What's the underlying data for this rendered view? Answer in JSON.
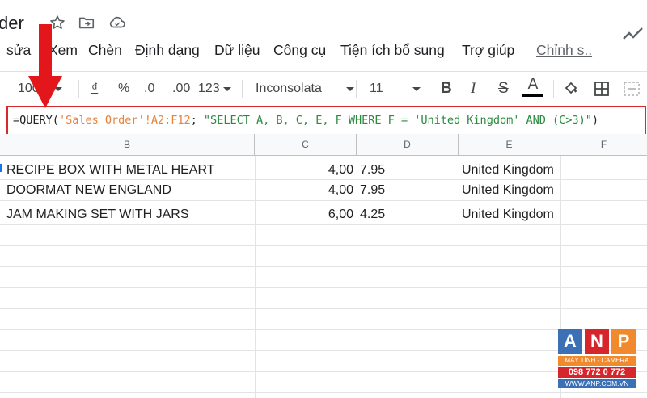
{
  "app": {
    "doc_title_fragment": "der"
  },
  "menu": {
    "items": [
      "sửa",
      "Xem",
      "Chèn",
      "Định dạng",
      "Dữ liệu",
      "Công cụ",
      "Tiện ích bổ sung",
      "Trợ giúp"
    ],
    "last_edit_link": "Chỉnh s.."
  },
  "toolbar": {
    "zoom": "100",
    "currency": "₫",
    "percent": "%",
    "decrease_decimal": ".0",
    "increase_decimal": ".00",
    "more_formats": "123",
    "font_family": "Inconsolata",
    "font_size": "11",
    "bold": "B",
    "italic": "I",
    "strikethrough": "S",
    "text_color": "A"
  },
  "formula": {
    "prefix": "=QUERY(",
    "range": "'Sales Order'!A2:F12",
    "separator": "; ",
    "query": "\"SELECT A, B, C, E, F WHERE F = 'United Kingdom' AND (C>3)\"",
    "suffix": ")"
  },
  "grid": {
    "columns": [
      "B",
      "C",
      "D",
      "E",
      "F"
    ],
    "rows": [
      {
        "b": "RECIPE BOX WITH METAL HEART",
        "c": "4,00",
        "d": "7.95",
        "e": "United Kingdom"
      },
      {
        "b": "DOORMAT NEW ENGLAND",
        "c": "4,00",
        "d": "7.95",
        "e": "United Kingdom"
      },
      {
        "b": "JAM MAKING SET WITH JARS",
        "c": "6,00",
        "d": "4.25",
        "e": "United Kingdom"
      }
    ]
  },
  "watermark": {
    "letters": [
      "A",
      "N",
      "P"
    ],
    "tagline": "MÁY TÍNH - CAMERA",
    "phone": "098 772 0 772",
    "website": "WWW.ANP.COM.VN"
  },
  "colors": {
    "highlight_border": "#d9262b",
    "arrow": "#e3171b",
    "formula_range": "#e8823a",
    "formula_string": "#2b8a3e"
  }
}
